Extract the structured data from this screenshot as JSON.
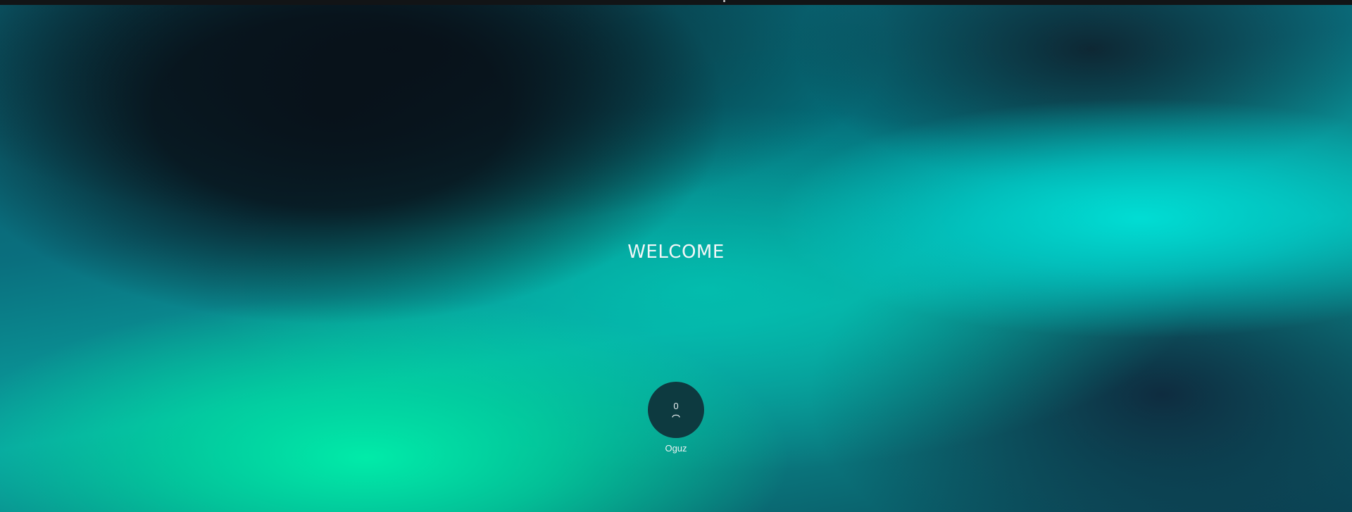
{
  "screen": {
    "welcome_text": "WELCOME"
  },
  "user": {
    "initial": "0",
    "name": "Oguz"
  },
  "icons": {
    "avatar_icon": "person-icon"
  },
  "colors": {
    "avatar_bg": "#0d3a40",
    "text": "#f2f6f7",
    "aurora_teal": "#00e1d7",
    "aurora_green": "#00f0aa"
  }
}
